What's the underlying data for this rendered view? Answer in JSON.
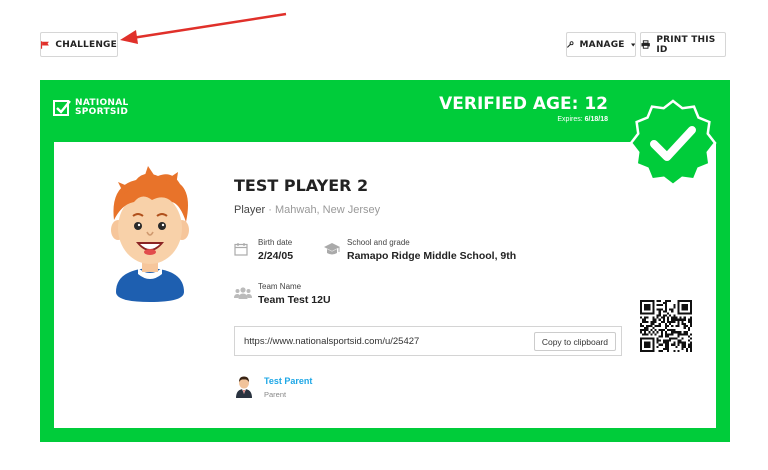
{
  "toolbar": {
    "challenge_label": "CHALLENGE",
    "manage_label": "MANAGE",
    "print_label": "PRINT THIS ID"
  },
  "card": {
    "logo_line1": "NATIONAL",
    "logo_line2": "SPORTSID",
    "verified_age": "VERIFIED AGE: 12",
    "expires_label": "Expires:",
    "expires_date": "6/18/18",
    "player_name": "TEST PLAYER 2",
    "role": "Player",
    "separator": "·",
    "location": "Mahwah, New Jersey",
    "birth_label": "Birth date",
    "birth_value": "2/24/05",
    "school_label": "School and grade",
    "school_value": "Ramapo Ridge Middle School, 9th",
    "team_label": "Team Name",
    "team_value": "Team Test 12U",
    "profile_url": "https://www.nationalsportsid.com/u/25427",
    "copy_label": "Copy to clipboard",
    "parent_name": "Test Parent",
    "parent_role": "Parent"
  },
  "colors": {
    "brand_green": "#00cc3a",
    "link_blue": "#1ea7e6",
    "annotation_red": "#e0302a"
  }
}
